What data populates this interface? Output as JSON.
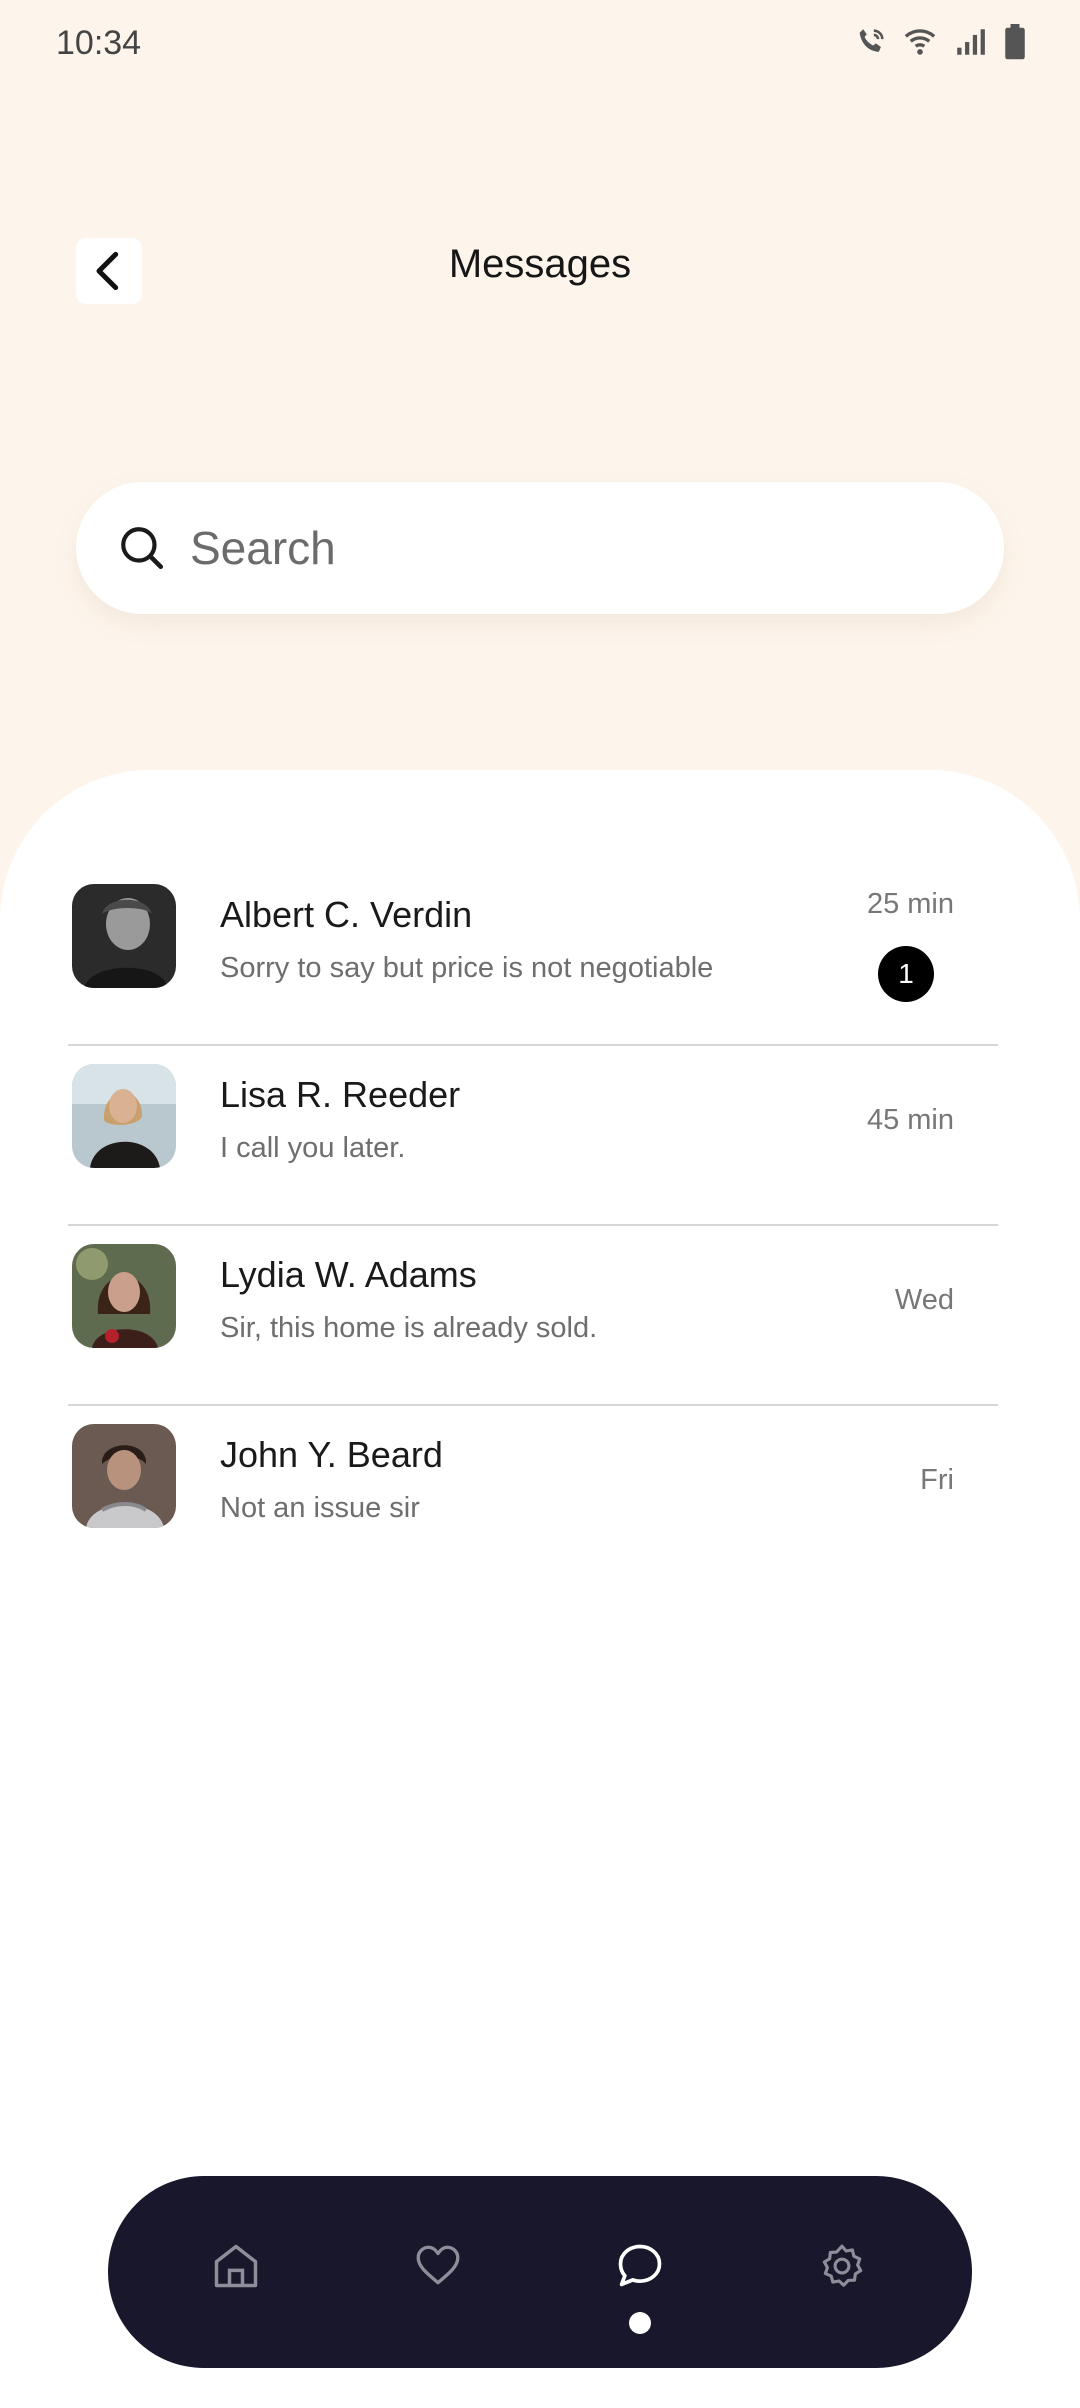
{
  "status_bar": {
    "time": "10:34"
  },
  "header": {
    "title": "Messages"
  },
  "search": {
    "placeholder": "Search"
  },
  "conversations": [
    {
      "name": "Albert C. Verdin",
      "preview": "Sorry to say but price is not negotiable",
      "time": "25 min",
      "unread": "1"
    },
    {
      "name": "Lisa R. Reeder",
      "preview": "I call you later.",
      "time": "45 min"
    },
    {
      "name": "Lydia W. Adams",
      "preview": "Sir, this home is already sold.",
      "time": "Wed"
    },
    {
      "name": "John Y. Beard",
      "preview": "Not an issue sir",
      "time": "Fri"
    }
  ],
  "bottom_nav": {
    "items": [
      "home-icon",
      "heart-icon",
      "chat-icon",
      "settings-icon"
    ],
    "active": "chat-icon"
  },
  "colors": {
    "background": "#FDF5EC",
    "nav": "#18172B",
    "badge": "#000000"
  }
}
